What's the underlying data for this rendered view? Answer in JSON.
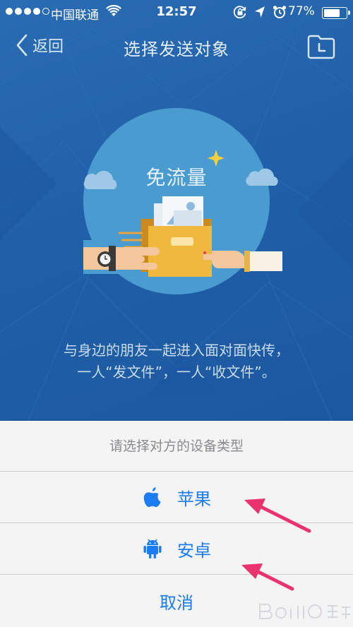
{
  "status_bar": {
    "carrier": "中国联通",
    "time": "12:57",
    "battery_percent": "77%",
    "battery_level": 0.77
  },
  "nav": {
    "back_label": "返回",
    "title": "选择发送对象"
  },
  "hero": {
    "label": "免流量"
  },
  "description": {
    "line1": "与身边的朋友一起进入面对面快传，",
    "line2": "一人“发文件”，一人“收文件”。"
  },
  "sheet": {
    "title": "请选择对方的设备类型",
    "options": [
      {
        "label": "苹果",
        "icon": "apple-icon"
      },
      {
        "label": "安卓",
        "icon": "android-icon"
      }
    ],
    "cancel_label": "取消"
  },
  "colors": {
    "accent": "#1a7cf0",
    "header_blue": "#2060a8",
    "annotation_arrow": "#e8336e"
  }
}
